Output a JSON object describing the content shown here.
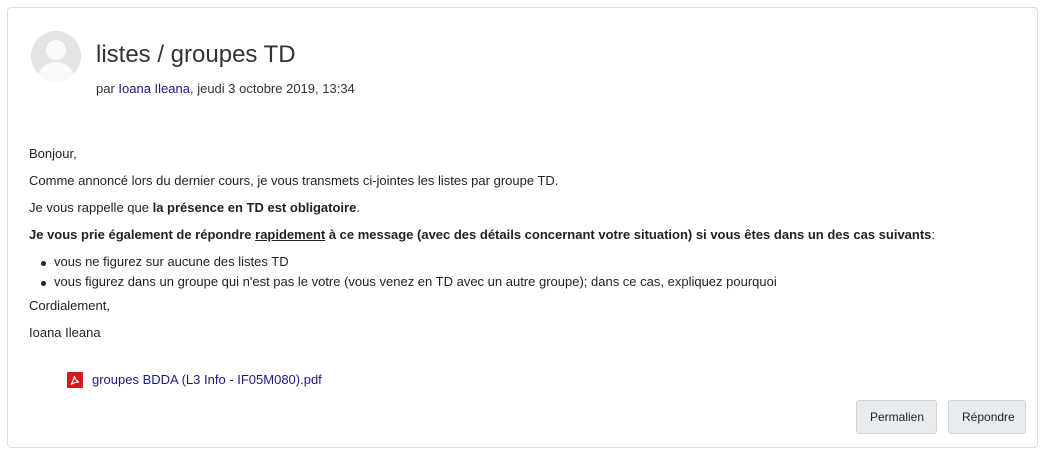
{
  "post": {
    "title": "listes / groupes TD",
    "byline_prefix": "par ",
    "author": "Ioana Ileana",
    "date": ", jeudi 3 octobre 2019, 13:34"
  },
  "message": {
    "greeting": "Bonjour,",
    "line1": "Comme annoncé lors du dernier cours, je vous transmets ci-jointes les listes par groupe TD.",
    "line2_prefix": "Je vous rappelle que ",
    "line2_bold": "la présence en TD est obligatoire",
    "line2_suffix": ".",
    "line3_part1": "Je vous prie également de répondre ",
    "line3_underlined": "rapidement",
    "line3_part2": " à ce message (avec des détails concernant votre situation) si vous êtes dans un des cas suivants",
    "line3_colon": ":",
    "list": [
      "vous ne figurez sur aucune des listes TD",
      "vous figurez dans un groupe qui n'est pas le votre (vous venez en TD avec un autre groupe); dans ce cas, expliquez pourquoi"
    ],
    "closing": "Cordialement,",
    "signature": "Ioana Ileana"
  },
  "attachment": {
    "filename": "groupes BDDA (L3 Info - IF05M080).pdf",
    "icon": "pdf-icon"
  },
  "actions": {
    "permalink_label": "Permalien",
    "reply_label": "Répondre"
  },
  "colors": {
    "link": "#1a1a86",
    "border": "#dcdcdc",
    "button_bg": "#e9ecef",
    "pdf_red": "#d21b1b"
  }
}
